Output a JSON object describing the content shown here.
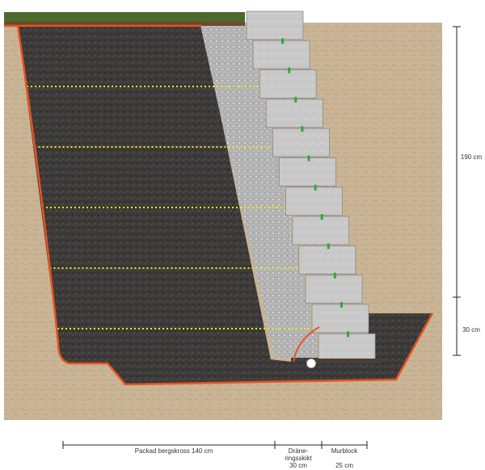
{
  "colors": {
    "soil": "#c9b596",
    "grass": "#4d6a2c",
    "backfill": "#3d3b39",
    "gravel": "#b8b8b8",
    "block": "#c9c9c9",
    "membrane": "#e8531f",
    "geogrid": "#f2e21a",
    "connector": "#2fa83a",
    "pipe": "#ffffff",
    "dimension": "#222222"
  },
  "blocks": {
    "count": 12
  },
  "geogrid_layers": 5,
  "labels": {
    "height_total": "190 cm",
    "height_base": "30 cm",
    "backfill": "Packad bergskross 140 cm",
    "drainage_line1": "Dräne-",
    "drainage_line2": "ringsskikt",
    "drainage_width": "30 cm",
    "block": "Murblock",
    "block_width": "25 cm"
  }
}
